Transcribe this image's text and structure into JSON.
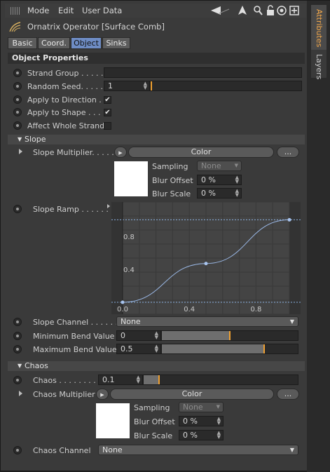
{
  "menubar": {
    "mode": "Mode",
    "edit": "Edit",
    "user_data": "User Data"
  },
  "title": "Ornatrix Operator [Surface Comb]",
  "tabs": [
    "Basic",
    "Coord.",
    "Object",
    "Sinks"
  ],
  "side_tabs": {
    "attributes": "Attributes",
    "layers": "Layers"
  },
  "object_properties": {
    "header": "Object Properties",
    "strand_group": {
      "label": "Strand Group . . . . . .",
      "value": ""
    },
    "random_seed": {
      "label": "Random Seed. . . . . .",
      "value": "1"
    },
    "apply_to_direction": {
      "label": "Apply to Direction . .",
      "checked": "✔"
    },
    "apply_to_shape": {
      "label": "Apply to Shape . . . .",
      "checked": "✔"
    },
    "affect_whole_strand": {
      "label": "Affect Whole Strand",
      "checked": ""
    }
  },
  "slope": {
    "header": "Slope",
    "multiplier_label": "Slope Multiplier. . . . .",
    "color_button": "Color",
    "more_button": "...",
    "sampling_label": "Sampling",
    "sampling_value": "None",
    "blur_offset_label": "Blur Offset",
    "blur_offset_value": "0 %",
    "blur_scale_label": "Blur Scale",
    "blur_scale_value": "0 %",
    "ramp_label": "Slope Ramp . . . . . .",
    "channel_label": "Slope Channel . . . . . .",
    "channel_value": "None",
    "min_bend_label": "Minimum Bend Value",
    "min_bend_value": "0",
    "min_bend_fraction": 0.5,
    "max_bend_label": "Maximum Bend Value",
    "max_bend_value": "0.5",
    "max_bend_fraction": 0.75
  },
  "chart_data": {
    "type": "line",
    "x_ticks": [
      "0.0",
      "0.4",
      "0.8"
    ],
    "y_ticks": [
      "0.4",
      "0.8"
    ],
    "xlim": [
      0,
      1
    ],
    "ylim": [
      0,
      1.08
    ],
    "grid": true,
    "points": [
      {
        "x": 0,
        "y": 0
      },
      {
        "x": 0.5,
        "y": 0.47
      },
      {
        "x": 1,
        "y": 1
      }
    ]
  },
  "chaos": {
    "header": "Chaos",
    "value_label": "Chaos . . . . . . . . .",
    "value": "0.1",
    "value_fraction": 0.1,
    "multiplier_label": "Chaos Multiplier",
    "color_button": "Color",
    "more_button": "...",
    "sampling_label": "Sampling",
    "sampling_value": "None",
    "blur_offset_label": "Blur Offset",
    "blur_offset_value": "0 %",
    "blur_scale_label": "Blur Scale",
    "blur_scale_value": "0 %",
    "channel_label": "Chaos Channel",
    "channel_value": "None"
  }
}
